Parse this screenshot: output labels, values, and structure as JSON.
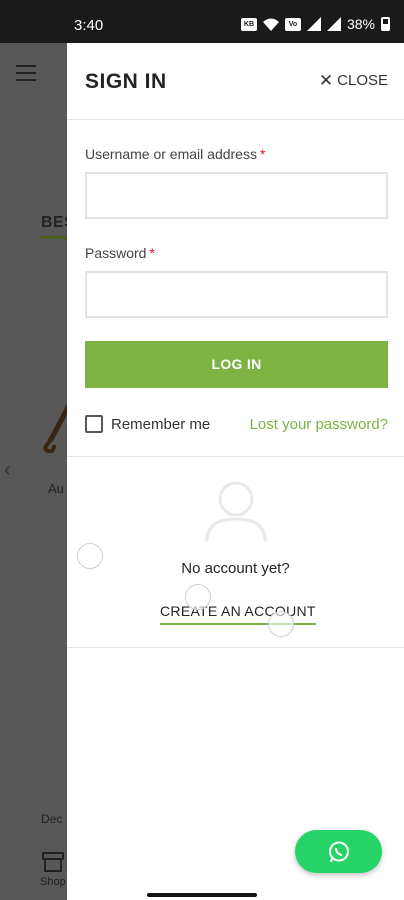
{
  "status_bar": {
    "time": "3:40",
    "battery": "38%",
    "icons": [
      "data-speed-icon",
      "wifi-icon",
      "volte-icon",
      "signal-icon",
      "signal-icon",
      "battery-icon"
    ]
  },
  "background_page": {
    "heading": "BES",
    "item_label": "Au",
    "bottom_text": "Dec",
    "shop_label": "Shop"
  },
  "drawer": {
    "title": "SIGN IN",
    "close_label": "CLOSE",
    "username_label": "Username or email address",
    "password_label": "Password",
    "required_mark": "*",
    "login_label": "LOG IN",
    "remember_label": "Remember me",
    "lost_password_label": "Lost your password?",
    "no_account_text": "No account yet?",
    "create_account_label": "CREATE AN ACCOUNT"
  },
  "colors": {
    "accent_green": "#7cb342",
    "whatsapp_green": "#25d366",
    "required_red": "#e01020"
  }
}
